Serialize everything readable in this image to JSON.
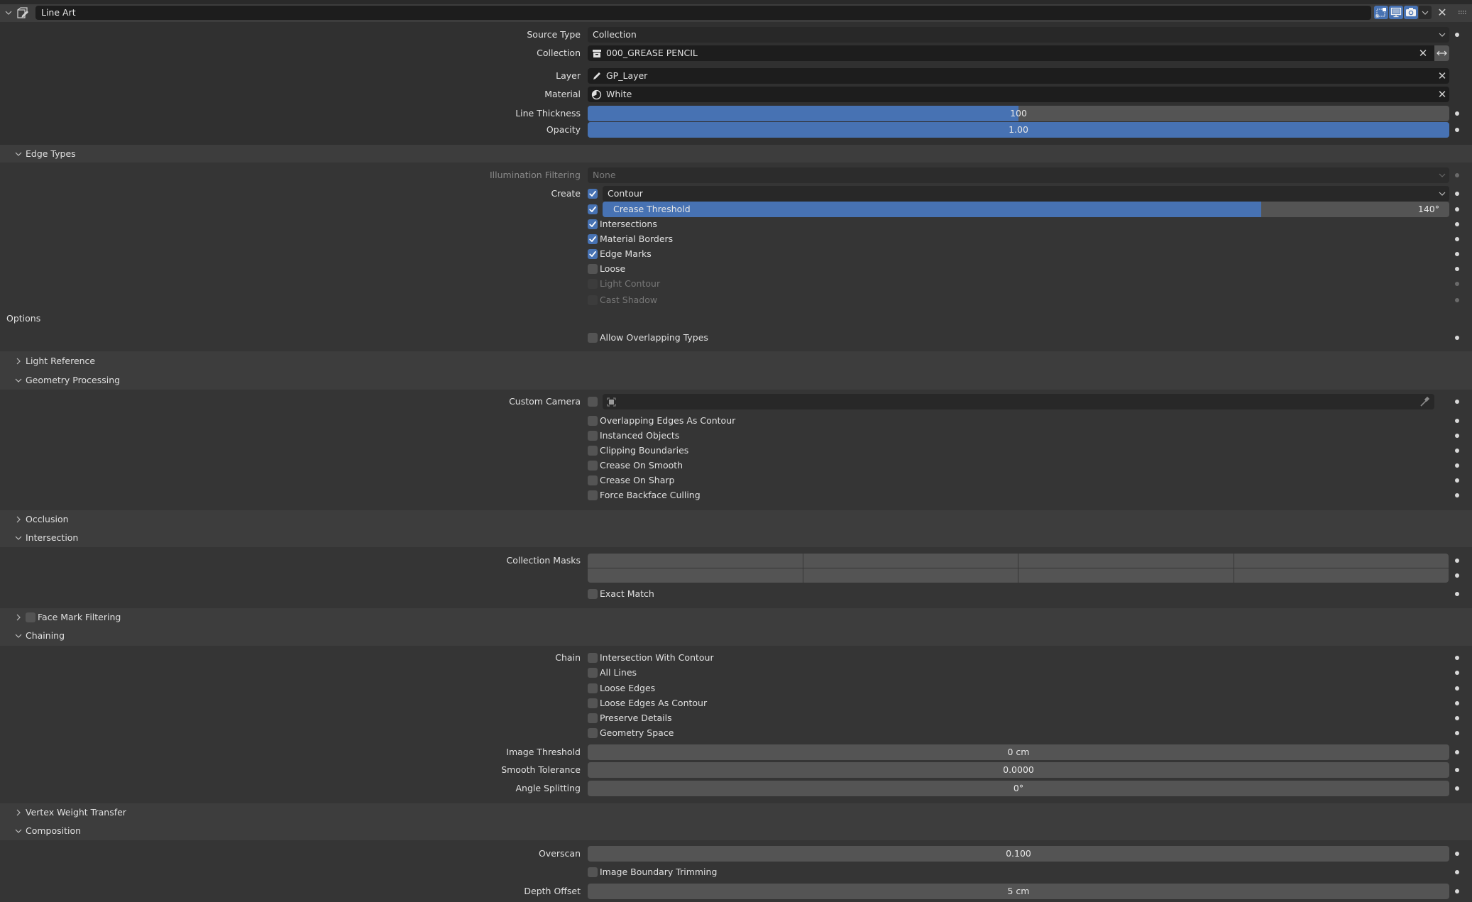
{
  "modifier": {
    "name": "Line Art",
    "header_toggles": [
      "edit-mode-icon",
      "viewport-display-icon",
      "render-icon"
    ],
    "menu_icon": "chevron-down-icon",
    "close_icon": "close-icon",
    "drag_handle": "drag-handle-icon"
  },
  "main": {
    "source_type": {
      "label": "Source Type",
      "value": "Collection"
    },
    "collection": {
      "label": "Collection",
      "value": "000_GREASE PENCIL",
      "icon": "collection-icon"
    },
    "layer": {
      "label": "Layer",
      "value": "GP_Layer",
      "icon": "pencil-icon"
    },
    "material": {
      "label": "Material",
      "value": "White",
      "icon": "material-icon"
    },
    "line_thickness": {
      "label": "Line Thickness",
      "value": "100",
      "fraction": 0.5
    },
    "opacity": {
      "label": "Opacity",
      "value": "1.00",
      "fraction": 1.0
    }
  },
  "edge_types": {
    "title": "Edge Types",
    "illumination": {
      "label": "Illumination Filtering",
      "value": "None"
    },
    "create_label": "Create",
    "contour": {
      "checked": true,
      "value": "Contour"
    },
    "crease": {
      "checked": true,
      "label": "Crease Threshold",
      "value": "140°",
      "fraction": 0.778
    },
    "items": [
      {
        "label": "Intersections",
        "checked": true,
        "disabled": false
      },
      {
        "label": "Material Borders",
        "checked": true,
        "disabled": false
      },
      {
        "label": "Edge Marks",
        "checked": true,
        "disabled": false
      },
      {
        "label": "Loose",
        "checked": false,
        "disabled": false
      },
      {
        "label": "Light Contour",
        "checked": false,
        "disabled": true
      },
      {
        "label": "Cast Shadow",
        "checked": false,
        "disabled": true
      }
    ],
    "options_label": "Options",
    "allow_overlapping": {
      "label": "Allow Overlapping Types",
      "checked": false
    }
  },
  "light_reference": {
    "title": "Light Reference",
    "expanded": false
  },
  "geometry_processing": {
    "title": "Geometry Processing",
    "expanded": true,
    "custom_camera": {
      "label": "Custom Camera",
      "checked": false,
      "value": ""
    },
    "items": [
      {
        "label": "Overlapping Edges As Contour",
        "checked": false
      },
      {
        "label": "Instanced Objects",
        "checked": false
      },
      {
        "label": "Clipping Boundaries",
        "checked": false
      },
      {
        "label": "Crease On Smooth",
        "checked": false
      },
      {
        "label": "Crease On Sharp",
        "checked": false
      },
      {
        "label": "Force Backface Culling",
        "checked": false
      }
    ]
  },
  "occlusion": {
    "title": "Occlusion",
    "expanded": false
  },
  "intersection": {
    "title": "Intersection",
    "expanded": true,
    "collection_masks_label": "Collection Masks",
    "collection_masks": [
      false,
      false,
      false,
      false,
      false,
      false,
      false,
      false
    ],
    "exact_match": {
      "label": "Exact Match",
      "checked": false
    }
  },
  "face_mark_filtering": {
    "title": "Face Mark Filtering",
    "expanded": false,
    "enabled": false
  },
  "chaining": {
    "title": "Chaining",
    "expanded": true,
    "chain_label": "Chain",
    "items": [
      {
        "label": "Intersection With Contour",
        "checked": false
      },
      {
        "label": "All Lines",
        "checked": false
      },
      {
        "label": "Loose Edges",
        "checked": false
      },
      {
        "label": "Loose Edges As Contour",
        "checked": false
      },
      {
        "label": "Preserve Details",
        "checked": false
      },
      {
        "label": "Geometry Space",
        "checked": false
      }
    ],
    "image_threshold": {
      "label": "Image Threshold",
      "value": "0 cm"
    },
    "smooth_tolerance": {
      "label": "Smooth Tolerance",
      "value": "0.0000"
    },
    "angle_splitting": {
      "label": "Angle Splitting",
      "value": "0°"
    }
  },
  "vertex_weight_transfer": {
    "title": "Vertex Weight Transfer",
    "expanded": false
  },
  "composition": {
    "title": "Composition",
    "expanded": true,
    "overscan": {
      "label": "Overscan",
      "value": "0.100"
    },
    "image_boundary_trimming": {
      "label": "Image Boundary Trimming",
      "checked": false
    },
    "depth_offset": {
      "label": "Depth Offset",
      "value": "5 cm"
    }
  },
  "colors": {
    "accent": "#4772b3",
    "panel_bg": "#353535",
    "header_bg": "#3d3d3d",
    "field_dark": "#1d1d1d",
    "slider_bg": "#545454"
  }
}
